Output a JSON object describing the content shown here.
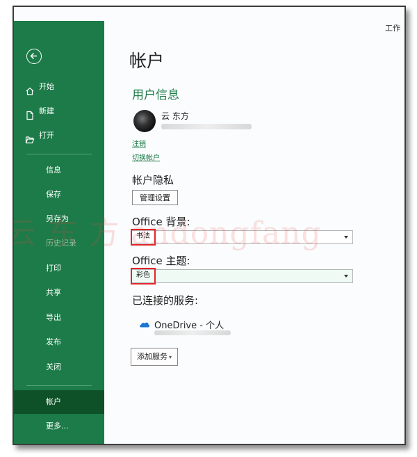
{
  "window": {
    "title_fragment": "工作"
  },
  "sidebar": {
    "items": [
      {
        "label": "开始",
        "icon": "home-icon"
      },
      {
        "label": "新建",
        "icon": "new-document-icon"
      },
      {
        "label": "打开",
        "icon": "open-folder-icon"
      },
      {
        "label": "信息"
      },
      {
        "label": "保存"
      },
      {
        "label": "另存为"
      },
      {
        "label": "历史记录",
        "disabled": true
      },
      {
        "label": "打印"
      },
      {
        "label": "共享"
      },
      {
        "label": "导出"
      },
      {
        "label": "发布"
      },
      {
        "label": "关闭"
      },
      {
        "label": "帐户",
        "selected": true
      },
      {
        "label": "更多..."
      }
    ],
    "accent": "#1c7b48",
    "selected_color": "#0e5128"
  },
  "main": {
    "title": "帐户",
    "user_info": {
      "heading": "用户信息",
      "name": "云 东方",
      "sign_out": "注销",
      "switch_account": "切换帐户"
    },
    "privacy": {
      "heading": "帐户隐私",
      "manage_button": "管理设置"
    },
    "background": {
      "label": "Office 背景:",
      "selected": "书法"
    },
    "theme": {
      "label": "Office 主题:",
      "selected": "彩色"
    },
    "services": {
      "heading": "已连接的服务:",
      "items": [
        {
          "name": "OneDrive - 个人",
          "icon": "onedrive-cloud-icon"
        }
      ],
      "add_button": "添加服务"
    }
  },
  "watermark": "云 东 方  andongfang",
  "colors": {
    "highlight_box": "#e3242b",
    "link": "#1c7b48"
  }
}
